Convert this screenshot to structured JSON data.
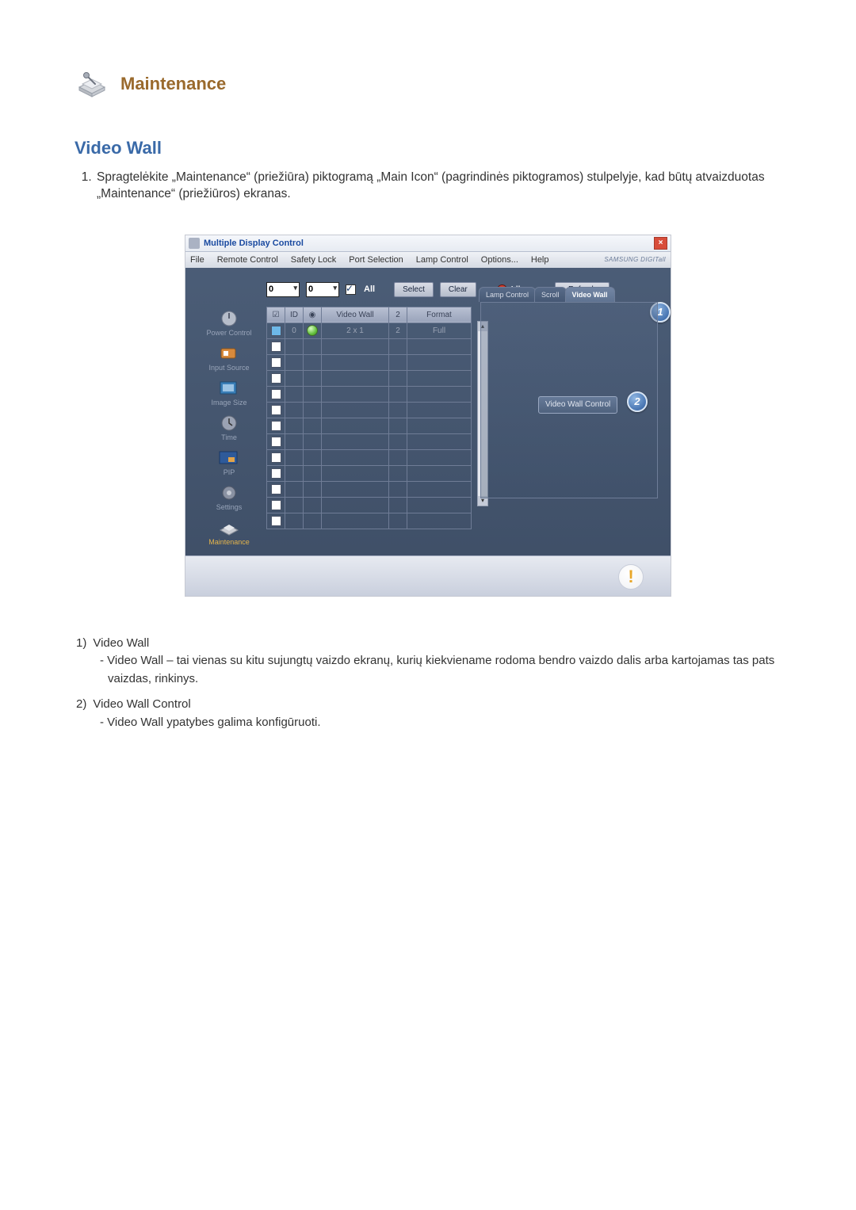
{
  "header": {
    "title": "Maintenance"
  },
  "section": {
    "title": "Video Wall"
  },
  "intro_list": {
    "item1": "Spragtelėkite „Maintenance“ (priežiūra) piktogramą „Main Icon“ (pagrindinės piktogramos) stulpelyje, kad būtų atvaizduotas „Maintenance“ (priežiūros) ekranas."
  },
  "app": {
    "title": "Multiple Display Control",
    "close": "×",
    "menu": {
      "file": "File",
      "remote": "Remote Control",
      "safety": "Safety Lock",
      "port": "Port Selection",
      "lamp": "Lamp Control",
      "options": "Options...",
      "help": "Help"
    },
    "brand": "SAMSUNG DIGITall",
    "controls": {
      "drop1": "0",
      "drop2": "0",
      "all": "All",
      "select": "Select",
      "clear": "Clear",
      "idle": "Idle",
      "refresh": "Refresh"
    },
    "sidebar": {
      "power": "Power Control",
      "input": "Input Source",
      "image": "Image Size",
      "time": "Time",
      "pip": "PIP",
      "settings": "Settings",
      "maintenance": "Maintenance"
    },
    "table": {
      "h_chk": "☑",
      "h_id": "ID",
      "h_stat": "◉",
      "h_vw": "Video Wall",
      "h_two": "2",
      "h_fmt": "Format",
      "row1": {
        "id": "0",
        "vw": "2 x 1",
        "two": "2",
        "fmt": "Full"
      }
    },
    "tabs": {
      "lamp": "Lamp Control",
      "scroll": "Scroll",
      "videowall": "Video Wall"
    },
    "vwc": "Video Wall Control",
    "badges": {
      "b1": "1",
      "b2": "2"
    },
    "warn": "!"
  },
  "desc": {
    "n1": "1)",
    "t1": "Video Wall",
    "s1": "Video Wall – tai vienas su kitu sujungtų vaizdo ekranų, kurių kiekviename rodoma bendro vaizdo dalis arba kartojamas tas pats vaizdas, rinkinys.",
    "n2": "2)",
    "t2": "Video Wall Control",
    "s2": "Video Wall ypatybes galima konfigūruoti."
  }
}
